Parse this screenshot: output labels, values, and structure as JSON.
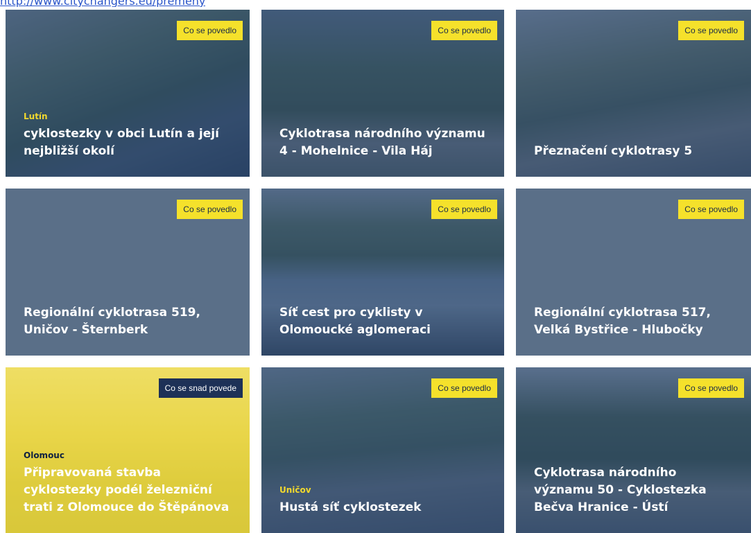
{
  "top_link": "http://www.citychangers.eu/premeny",
  "cards": [
    {
      "badge": "Co se povedlo",
      "location": "Lutín",
      "title": "cyklostezky v obci Lutín a její nejbližší okolí"
    },
    {
      "badge": "Co se povedlo",
      "location": "",
      "title": "Cyklotrasa národního významu 4 - Mohelnice - Vila Háj"
    },
    {
      "badge": "Co se povedlo",
      "location": "",
      "title": "Přeznačení cyklotrasy 5"
    },
    {
      "badge": "Co se povedlo",
      "location": "",
      "title": "Regionální cyklotrasa 519, Uničov - Šternberk"
    },
    {
      "badge": "Co se povedlo",
      "location": "",
      "title": "Síť cest pro cyklisty v Olomoucké aglomeraci"
    },
    {
      "badge": "Co se povedlo",
      "location": "",
      "title": "Regionální cyklotrasa 517, Velká Bystřice - Hlubočky"
    },
    {
      "badge": "Co se snad povede",
      "location": "Olomouc",
      "title": "Připravovaná stavba cyklostezky podél železniční trati z Olomouce do Štěpánova"
    },
    {
      "badge": "Co se povedlo",
      "location": "Uničov",
      "title": "Hustá síť cyklostezek"
    },
    {
      "badge": "Co se povedlo",
      "location": "",
      "title": "Cyklotrasa národního významu 50 - Cyklostezka Bečva Hranice - Ústí"
    }
  ],
  "colors": {
    "card_overlay": "#1e3a66",
    "card_plain": "#5a6f88",
    "card_yellow": "#e9d64a",
    "badge_yellow": "#f5e12b",
    "badge_dark": "#1d3157"
  }
}
